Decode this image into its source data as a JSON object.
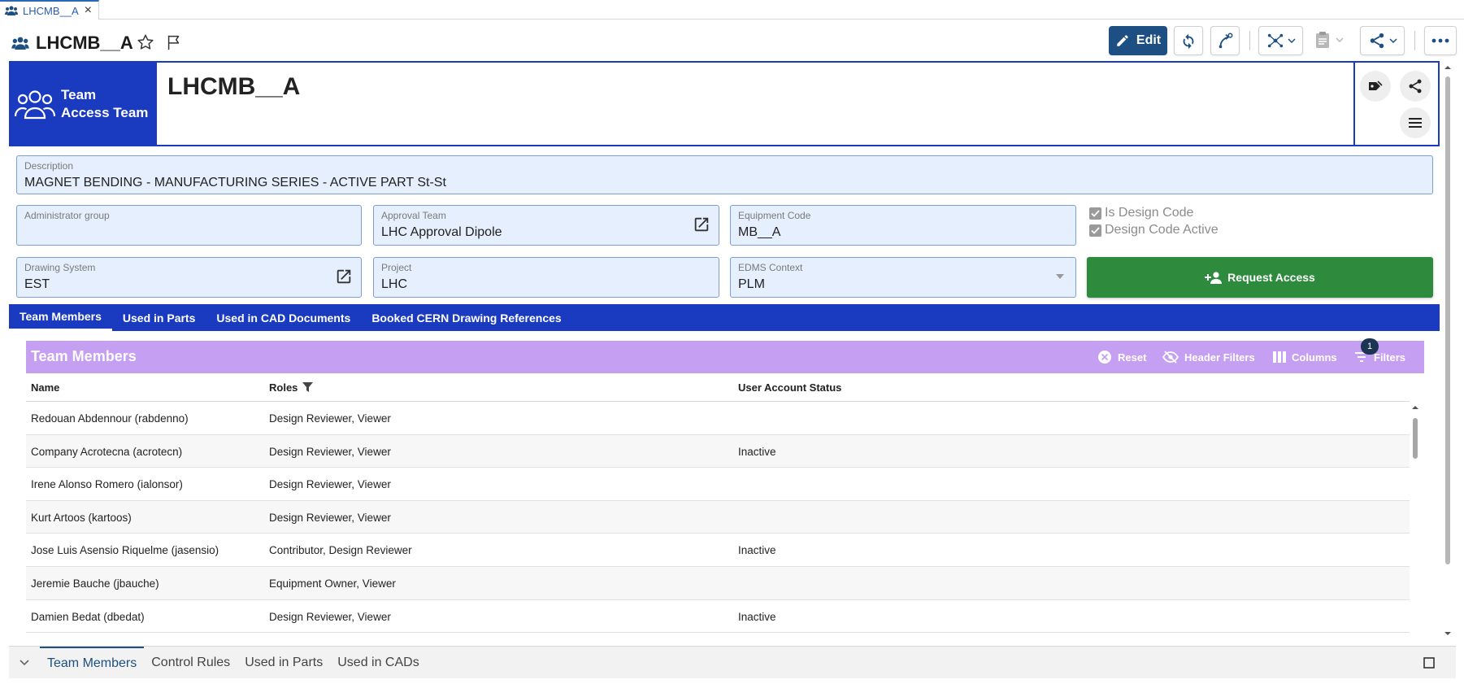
{
  "tab": {
    "label": "LHCMB__A",
    "close": "×"
  },
  "title": {
    "text": "LHCMB__A"
  },
  "toolbar": {
    "edit_label": "Edit"
  },
  "header": {
    "type_line1": "Team",
    "type_line2": "Access Team",
    "name": "LHCMB__A"
  },
  "fields": {
    "description": {
      "label": "Description",
      "value": "MAGNET BENDING - MANUFACTURING SERIES - ACTIVE PART St-St"
    },
    "admin_group": {
      "label": "Administrator group",
      "value": ""
    },
    "approval_team": {
      "label": "Approval Team",
      "value": "LHC Approval Dipole"
    },
    "equipment_code": {
      "label": "Equipment Code",
      "value": "MB__A"
    },
    "drawing_system": {
      "label": "Drawing System",
      "value": "EST"
    },
    "project": {
      "label": "Project",
      "value": "LHC"
    },
    "edms_context": {
      "label": "EDMS Context",
      "value": "PLM"
    },
    "is_design_code": {
      "label": "Is Design Code",
      "checked": true
    },
    "design_code_active": {
      "label": "Design Code Active",
      "checked": true
    }
  },
  "request_access": {
    "label": "Request Access"
  },
  "tabs": [
    {
      "label": "Team Members",
      "active": true
    },
    {
      "label": "Used in Parts",
      "active": false
    },
    {
      "label": "Used in CAD Documents",
      "active": false
    },
    {
      "label": "Booked CERN Drawing References",
      "active": false
    }
  ],
  "team_members": {
    "title": "Team Members",
    "tools": {
      "reset": "Reset",
      "header_filters": "Header Filters",
      "columns": "Columns",
      "filters": "Filters",
      "filters_count": "1"
    },
    "columns": [
      "Name",
      "Roles",
      "User Account Status"
    ],
    "rows": [
      {
        "name": "Redouan Abdennour (rabdenno)",
        "roles": "Design Reviewer, Viewer",
        "status": ""
      },
      {
        "name": "Company Acrotecna (acrotecn)",
        "roles": "Design Reviewer, Viewer",
        "status": "Inactive"
      },
      {
        "name": "Irene Alonso Romero (ialonsor)",
        "roles": "Design Reviewer, Viewer",
        "status": ""
      },
      {
        "name": "Kurt Artoos (kartoos)",
        "roles": "Design Reviewer, Viewer",
        "status": ""
      },
      {
        "name": "Jose Luis Asensio Riquelme (jasensio)",
        "roles": "Contributor, Design Reviewer",
        "status": "Inactive"
      },
      {
        "name": "Jeremie Bauche (jbauche)",
        "roles": "Equipment Owner, Viewer",
        "status": ""
      },
      {
        "name": "Damien Bedat (dbedat)",
        "roles": "Design Reviewer, Viewer",
        "status": "Inactive"
      }
    ]
  },
  "bottom_tabs": [
    {
      "label": "Team Members",
      "active": true
    },
    {
      "label": "Control Rules",
      "active": false
    },
    {
      "label": "Used in Parts",
      "active": false
    },
    {
      "label": "Used in CADs",
      "active": false
    }
  ],
  "colors": {
    "brand_blue": "#1a3bbf",
    "edit_blue": "#1d4f82",
    "request_green": "#2e8b3d",
    "panel_purple": "#c59ff1",
    "field_bg": "#e5effd"
  }
}
